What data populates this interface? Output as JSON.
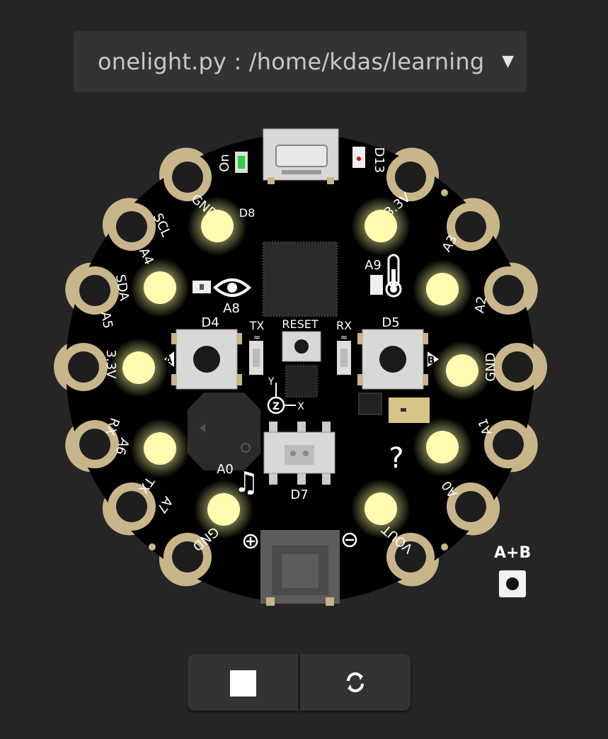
{
  "file_select": {
    "value": "onelight.py : /home/kdas/learning",
    "arrow": "▼"
  },
  "board": {
    "pad_labels": {
      "gnd_top_left": "GND",
      "scl_a4": "SCL",
      "a4": "A4",
      "sda_a5": "SDA",
      "a5": "A5",
      "v33_left": "3.3V",
      "rx_a6": "RX",
      "a6": "A6",
      "tx_a7": "TX",
      "a7": "A7",
      "gnd_bottom_left": "GND",
      "vout": "VOUT",
      "a0": "A0",
      "a1": "A1",
      "gnd_right": "GND",
      "a2": "A2",
      "a3": "A3",
      "v33_right": "3.3V"
    },
    "silkscreen": {
      "on": "On",
      "d13": "D13",
      "d8": "D8",
      "a8": "A8",
      "a9": "A9",
      "d4": "D4",
      "d5": "D5",
      "tx": "TX",
      "rx": "RX",
      "reset": "RESET",
      "a0_speaker": "A0",
      "d7": "D7",
      "btn_a": "A",
      "btn_b": "B",
      "axis_x": "X",
      "axis_y": "Y",
      "axis_z": "Z"
    },
    "leds_lit": 10,
    "led_color": "#fffcb0"
  },
  "ab_touch": {
    "label": "A+B"
  },
  "controls": {
    "stop": "stop-icon",
    "restart": "refresh-icon"
  }
}
